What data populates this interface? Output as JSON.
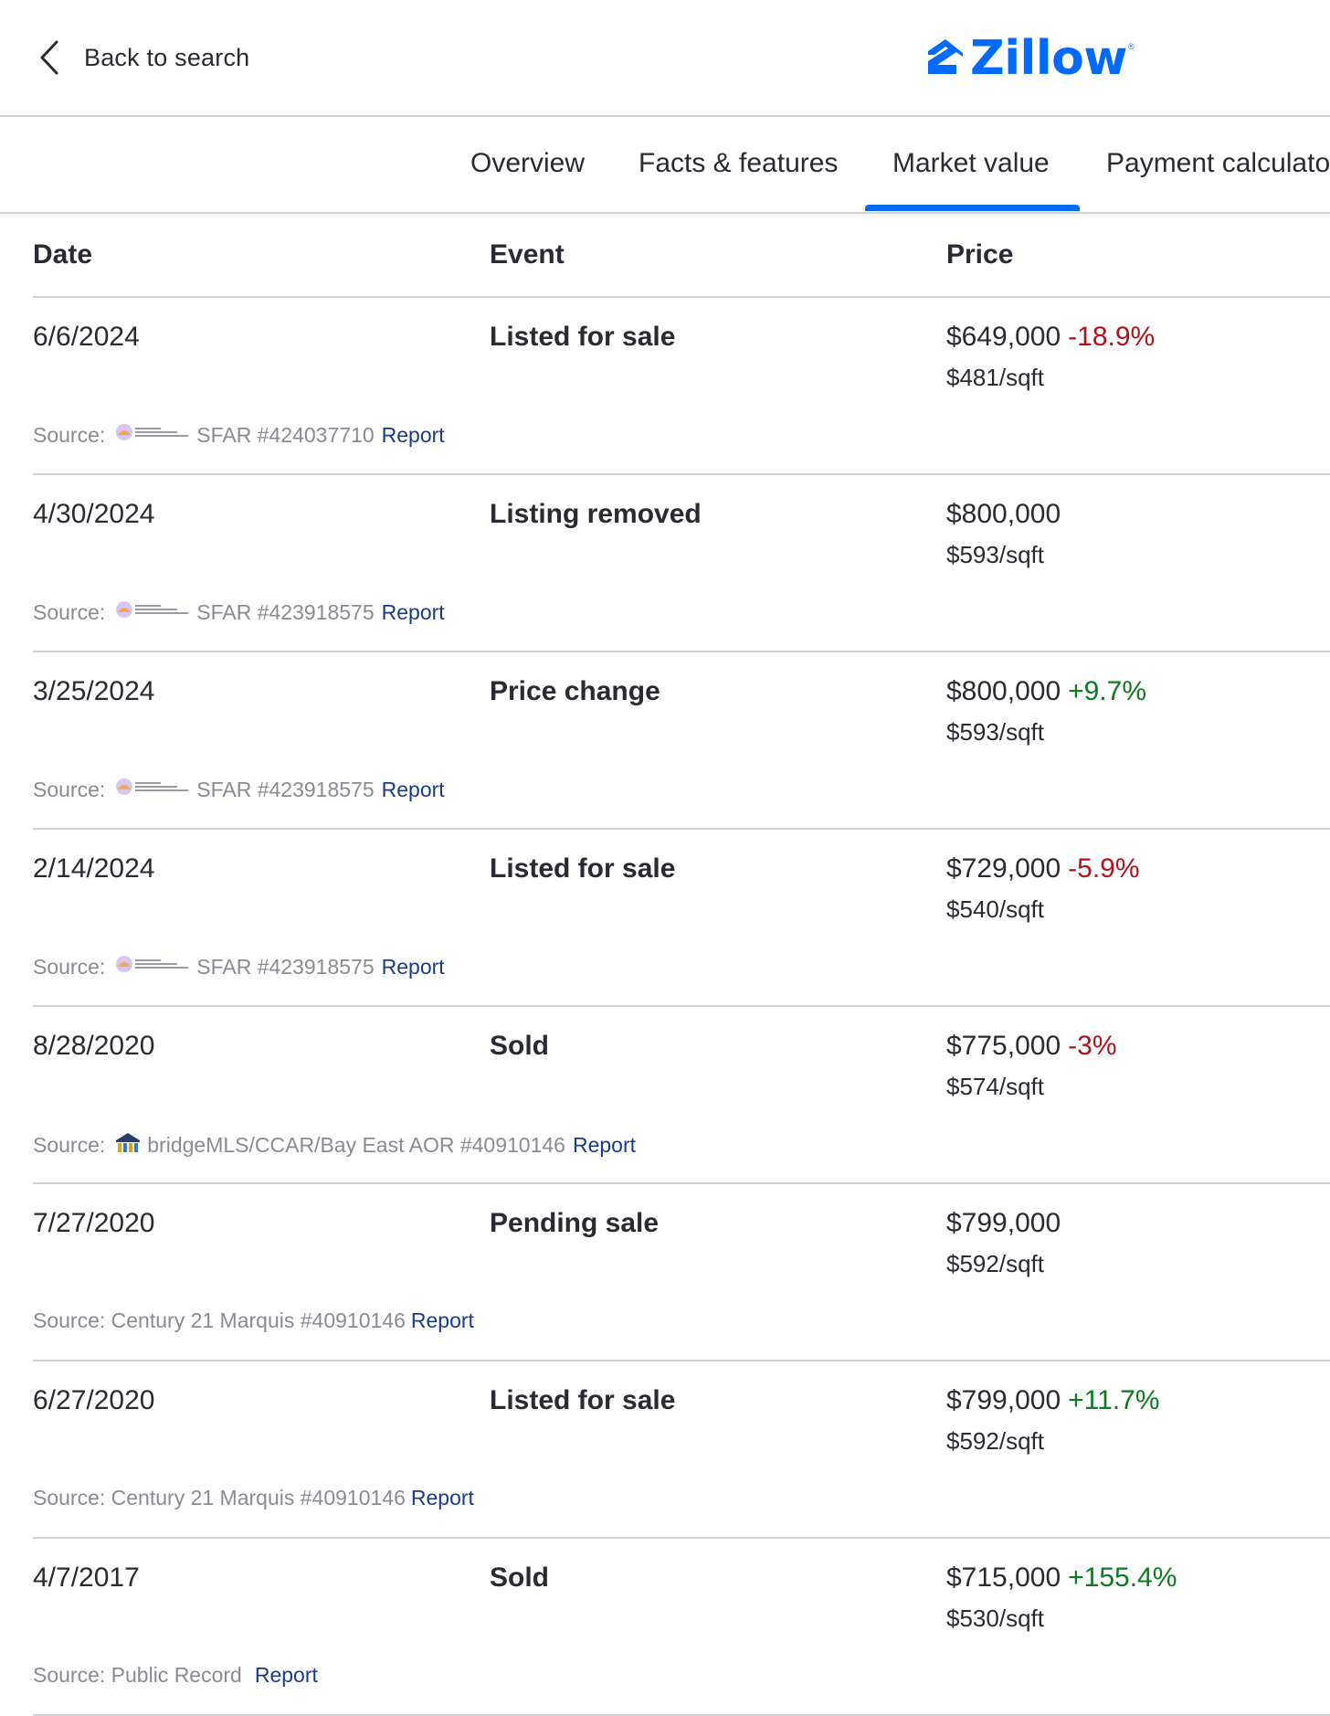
{
  "header": {
    "back_label": "Back to search",
    "logo_text": "Zillow",
    "logo_reg": "®",
    "brand_color": "#006aff"
  },
  "tabs": [
    {
      "label": "Overview"
    },
    {
      "label": "Facts & features"
    },
    {
      "label": "Market value",
      "active": true
    },
    {
      "label": "Payment calculato"
    }
  ],
  "table": {
    "headers": {
      "date": "Date",
      "event": "Event",
      "price": "Price"
    },
    "colors": {
      "negative": "#b0131a",
      "positive": "#0c7a1e",
      "link": "#1a3b8c"
    },
    "rows": [
      {
        "date": "6/6/2024",
        "event": "Listed for sale",
        "price": "$649,000",
        "change": "-18.9%",
        "sqft": "$481/sqft",
        "source_prefix": "Source:",
        "source_icon": "sfar-logo",
        "source_text": "SFAR #424037710",
        "report": "Report"
      },
      {
        "date": "4/30/2024",
        "event": "Listing removed",
        "price": "$800,000",
        "change": "",
        "sqft": "$593/sqft",
        "source_prefix": "Source:",
        "source_icon": "sfar-logo",
        "source_text": "SFAR #423918575",
        "report": "Report"
      },
      {
        "date": "3/25/2024",
        "event": "Price change",
        "price": "$800,000",
        "change": "+9.7%",
        "sqft": "$593/sqft",
        "source_prefix": "Source:",
        "source_icon": "sfar-logo",
        "source_text": "SFAR #423918575",
        "report": "Report"
      },
      {
        "date": "2/14/2024",
        "event": "Listed for sale",
        "price": "$729,000",
        "change": "-5.9%",
        "sqft": "$540/sqft",
        "source_prefix": "Source:",
        "source_icon": "sfar-logo",
        "source_text": "SFAR #423918575",
        "report": "Report"
      },
      {
        "date": "8/28/2020",
        "event": "Sold",
        "price": "$775,000",
        "change": "-3%",
        "sqft": "$574/sqft",
        "source_prefix": "Source:",
        "source_icon": "bridgemls-logo",
        "source_text": "bridgeMLS/CCAR/Bay East AOR #40910146",
        "report": "Report"
      },
      {
        "date": "7/27/2020",
        "event": "Pending sale",
        "price": "$799,000",
        "change": "",
        "sqft": "$592/sqft",
        "source_prefix": "Source: Century 21 Marquis #40910146",
        "source_icon": "",
        "source_text": "",
        "report": "Report"
      },
      {
        "date": "6/27/2020",
        "event": "Listed for sale",
        "price": "$799,000",
        "change": "+11.7%",
        "sqft": "$592/sqft",
        "source_prefix": "Source: Century 21 Marquis #40910146",
        "source_icon": "",
        "source_text": "",
        "report": "Report"
      },
      {
        "date": "4/7/2017",
        "event": "Sold",
        "price": "$715,000",
        "change": "+155.4%",
        "sqft": "$530/sqft",
        "source_prefix": "Source: Public Record",
        "source_icon": "",
        "source_text": "",
        "report": "Report"
      }
    ]
  }
}
